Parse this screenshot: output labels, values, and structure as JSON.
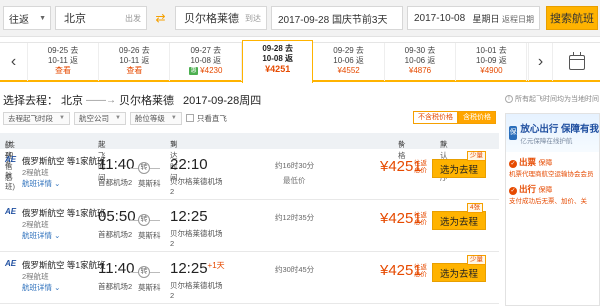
{
  "search": {
    "trip_type": "往返",
    "from_city": "北京",
    "from_hint": "出发",
    "to_city": "贝尔格莱德",
    "to_hint": "到达",
    "depart_date": "2017-09-28",
    "depart_note": "国庆节前3天",
    "return_date": "2017-10-08",
    "return_weekday": "星期日",
    "return_hint": "返程日期",
    "search_label": "搜索航班"
  },
  "date_strip": [
    {
      "depart": "09-25 去",
      "return": "10-11 返",
      "price": "查看",
      "active": false
    },
    {
      "depart": "09-26 去",
      "return": "10-11 返",
      "price": "查看",
      "active": false
    },
    {
      "depart": "09-27 去",
      "return": "10-08 返",
      "price": "¥4230",
      "active": false,
      "tag": true
    },
    {
      "depart": "09-28 去",
      "return": "10-08 返",
      "price": "¥4251",
      "active": true
    },
    {
      "depart": "09-29 去",
      "return": "10-06 返",
      "price": "¥4552",
      "active": false
    },
    {
      "depart": "09-30 去",
      "return": "10-06 返",
      "price": "¥4876",
      "active": false
    },
    {
      "depart": "10-01 去",
      "return": "10-09 返",
      "price": "¥4900",
      "active": false
    }
  ],
  "route": {
    "prefix": "选择去程：",
    "from": "北京",
    "to": "贝尔格莱德",
    "date": "2017-09-28周四"
  },
  "filters": {
    "dep_time": "去程起飞时段",
    "airline": "航空公司",
    "cabin": "舱位等级",
    "direct_only": "只看直飞"
  },
  "tax_toggle": {
    "excluded": "不含税价格",
    "included": "含税价格"
  },
  "table_head": {
    "flight_info": "航班信息",
    "count": "(共40条航班)",
    "dep_time": "起飞时间",
    "arr_time": "到达时间",
    "price": "价格",
    "sort": "默认排序"
  },
  "flights": [
    {
      "airline": "俄罗斯航空 等1家航班",
      "transfers": "2程航班",
      "detail": "航班详情",
      "dep_time": "11:40",
      "dep_airport": "首都机场2",
      "transfer_city": "莫斯科",
      "arr_time": "22:10",
      "plus_day": "",
      "arr_airport": "贝尔格莱德机场",
      "arr_airport2": "2",
      "duration": "约16时30分",
      "lowest": "最低价",
      "price": "¥4251",
      "price_note": "往返总价",
      "book": "选为去程",
      "badge": "少量"
    },
    {
      "airline": "俄罗斯航空 等1家航班",
      "transfers": "2程航班",
      "detail": "航班详情",
      "dep_time": "05:50",
      "dep_airport": "首都机场2",
      "transfer_city": "莫斯科",
      "arr_time": "12:25",
      "plus_day": "",
      "arr_airport": "贝尔格莱德机场",
      "arr_airport2": "2",
      "duration": "约12时35分",
      "lowest": "",
      "price": "¥4251",
      "price_note": "往返总价",
      "book": "选为去程",
      "badge": "4张"
    },
    {
      "airline": "俄罗斯航空 等1家航班",
      "transfers": "2程航班",
      "detail": "航班详情",
      "dep_time": "11:40",
      "dep_airport": "首都机场2",
      "transfer_city": "莫斯科",
      "arr_time": "12:25",
      "plus_day": "+1天",
      "arr_airport": "贝尔格莱德机场",
      "arr_airport2": "2",
      "duration": "约30时45分",
      "lowest": "",
      "price": "¥4251",
      "price_note": "往返总价",
      "book": "选为去程",
      "badge": "少量"
    }
  ],
  "side": {
    "note": "所有起飞时间均为当地时间",
    "promo_logo": "保",
    "promo_title": "放心出行 保障有我",
    "promo_sub": "亿元保障在线护航",
    "g1_title": "出票",
    "g1_sub": "保障",
    "g1_desc": "机票代理商航空运输协会会员",
    "g2_title": "出行",
    "g2_sub": "保障",
    "g2_desc": "支付成功后无票、加价、关"
  },
  "colors": {
    "accent": "#ffb300",
    "price": "#e64a00",
    "link": "#2a6ebb"
  }
}
